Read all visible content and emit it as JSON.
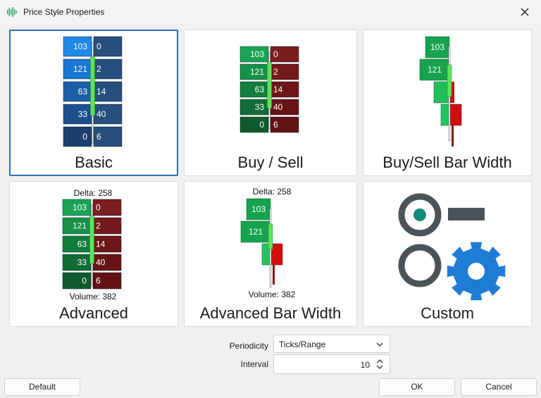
{
  "window": {
    "title": "Price Style Properties"
  },
  "styles": [
    {
      "label": "Basic",
      "selected": true
    },
    {
      "label": "Buy / Sell",
      "selected": false
    },
    {
      "label": "Buy/Sell Bar Width",
      "selected": false
    },
    {
      "label": "Advanced",
      "selected": false,
      "delta": "Delta: 258",
      "volume": "Volume: 382"
    },
    {
      "label": "Advanced Bar Width",
      "selected": false,
      "delta": "Delta: 258",
      "volume": "Volume: 382"
    },
    {
      "label": "Custom",
      "selected": false
    }
  ],
  "ladder": {
    "bid": [
      "103",
      "121",
      "63",
      "33",
      "0"
    ],
    "ask": [
      "0",
      "2",
      "14",
      "40",
      "6"
    ]
  },
  "bar_width": {
    "bid": [
      "103",
      "121"
    ]
  },
  "colors": {
    "accent": "#2b6fb0",
    "basic_blue": [
      "#1e88e5",
      "#1976d2",
      "#1c5fa6",
      "#1a4f8c",
      "#1b3f6a"
    ],
    "buy_green": [
      "#1aa355",
      "#169147",
      "#127e3c",
      "#106c34",
      "#0f5a2c"
    ],
    "sell_red": [
      "#7a1e20",
      "#74191c",
      "#6e1618",
      "#681416",
      "#621214"
    ],
    "custom_gray": "#4a5358",
    "custom_teal": "#138a78",
    "custom_gear": "#1e7bd6"
  },
  "icons": {
    "app": "waveform-icon",
    "close": "close-icon",
    "chevron": "chevron-down-icon",
    "spin": "spin-arrows-icon",
    "custom": "settings-toggle-gear-icon"
  },
  "form": {
    "periodicity_label": "Periodicity",
    "periodicity_value": "Ticks/Range",
    "interval_label": "Interval",
    "interval_value": "10"
  },
  "buttons": {
    "default": "Default",
    "ok": "OK",
    "cancel": "Cancel"
  }
}
